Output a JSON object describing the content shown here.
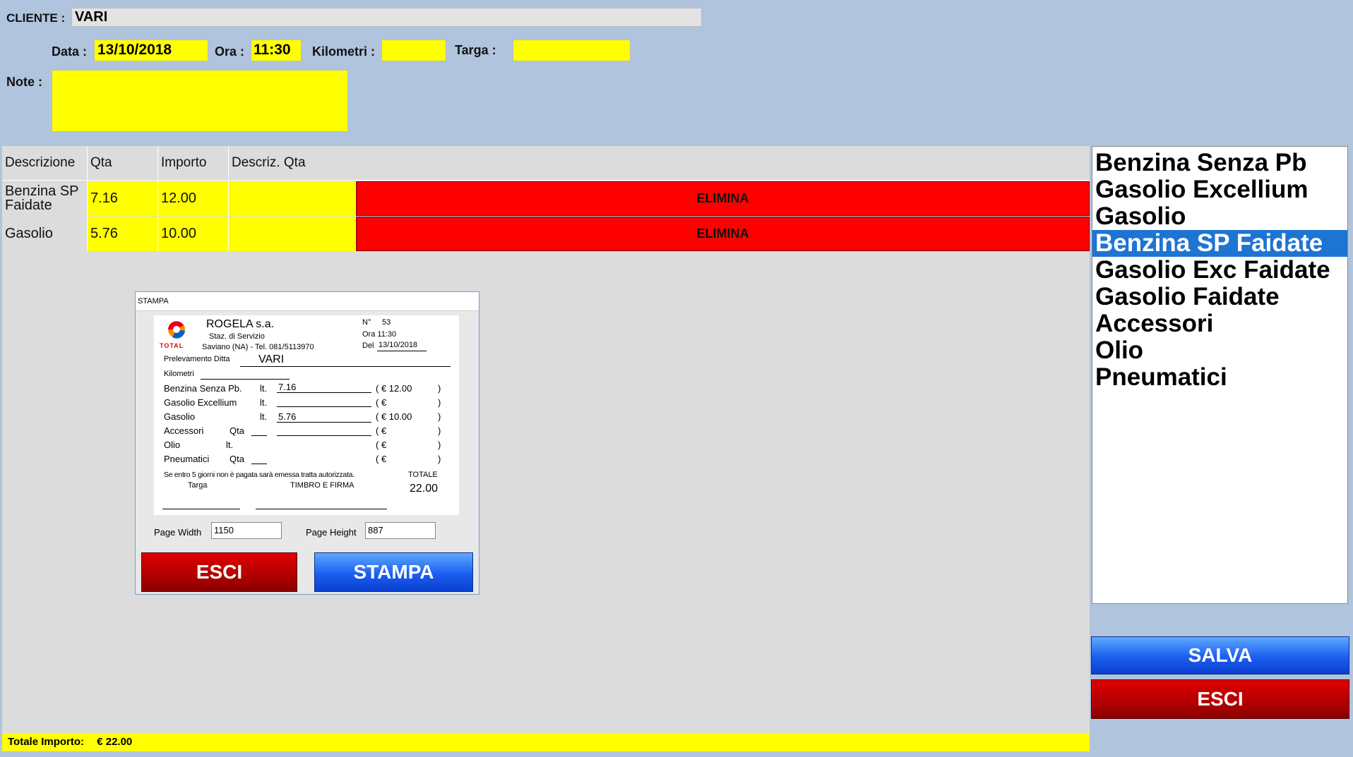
{
  "header": {
    "cliente_label": "CLIENTE :",
    "cliente_value": "VARI",
    "data_label": "Data :",
    "data_value": "13/10/2018",
    "ora_label": "Ora :",
    "ora_value": "11:30",
    "km_label": "Kilometri :",
    "km_value": "",
    "targa_label": "Targa :",
    "targa_value": "",
    "note_label": "Note :",
    "note_value": ""
  },
  "table": {
    "headers": [
      "Descrizione",
      "Qta",
      "Importo",
      "Descriz. Qta"
    ],
    "rows": [
      {
        "descrizione": "Benzina SP Faidate",
        "qta": "7.16",
        "importo": "12.00",
        "descriz_qta": "",
        "action": "ELIMINA"
      },
      {
        "descrizione": "Gasolio",
        "qta": "5.76",
        "importo": "10.00",
        "descriz_qta": "",
        "action": "ELIMINA"
      }
    ]
  },
  "products": {
    "items": [
      "Benzina Senza Pb",
      "Gasolio Excellium",
      "Gasolio",
      "Benzina SP Faidate",
      "Gasolio Exc Faidate",
      "Gasolio Faidate",
      "Accessori",
      "Olio",
      "Pneumatici"
    ],
    "selected_index": 3
  },
  "buttons": {
    "salva": "SALVA",
    "esci": "ESCI"
  },
  "footer": {
    "totale_label": "Totale Importo:",
    "totale_value": "€ 22.00"
  },
  "dialog": {
    "title": "STAMPA",
    "receipt": {
      "brand": "TOTAL",
      "company": "ROGELA s.a.",
      "subtitle": "Staz. di Servizio",
      "address": "Saviano (NA) - Tel. 081/5113970",
      "numero_label": "N°",
      "numero_value": "53",
      "ora": "Ora 11:30",
      "del_label": "Del",
      "del_value": "13/10/2018",
      "prelevamento_label": "Prelevamento Ditta",
      "prelevamento_value": "VARI",
      "kilometri_label": "Kilometri",
      "lines": [
        {
          "name": "Benzina Senza Pb.",
          "unit": "lt.",
          "qty": "7.16",
          "euro": "( € 12.00",
          "close": ")"
        },
        {
          "name": "Gasolio Excellium",
          "unit": "lt.",
          "qty": "",
          "euro": "( €",
          "close": ")"
        },
        {
          "name": "Gasolio",
          "unit": "lt.",
          "qty": "5.76",
          "euro": "( € 10.00",
          "close": ")"
        },
        {
          "name": "Accessori",
          "unit": "Qta",
          "qty": "",
          "euro": "( €",
          "close": ")"
        },
        {
          "name": "Olio",
          "unit": "lt.",
          "qty": "",
          "euro": "( €",
          "close": ")"
        },
        {
          "name": "Pneumatici",
          "unit": "Qta",
          "qty": "",
          "euro": "( €",
          "close": ")"
        }
      ],
      "notice": "Se entro 5 giorni non è pagata sarà emessa tratta autorizzata.",
      "totale_label": "TOTALE",
      "totale_value": "22.00",
      "targa_label": "Targa",
      "firma_label": "TIMBRO E FIRMA"
    },
    "page_width_label": "Page Width",
    "page_width_value": "1150",
    "page_height_label": "Page Height",
    "page_height_value": "887",
    "esci": "ESCI",
    "stampa": "STAMPA"
  },
  "colors": {
    "background": "#b0c4de",
    "field_yellow": "#ffff00",
    "delete_red": "#ff0000",
    "selected_blue": "#1e74d2",
    "save_blue": "#1c5ef0",
    "exit_red": "#b00000"
  }
}
